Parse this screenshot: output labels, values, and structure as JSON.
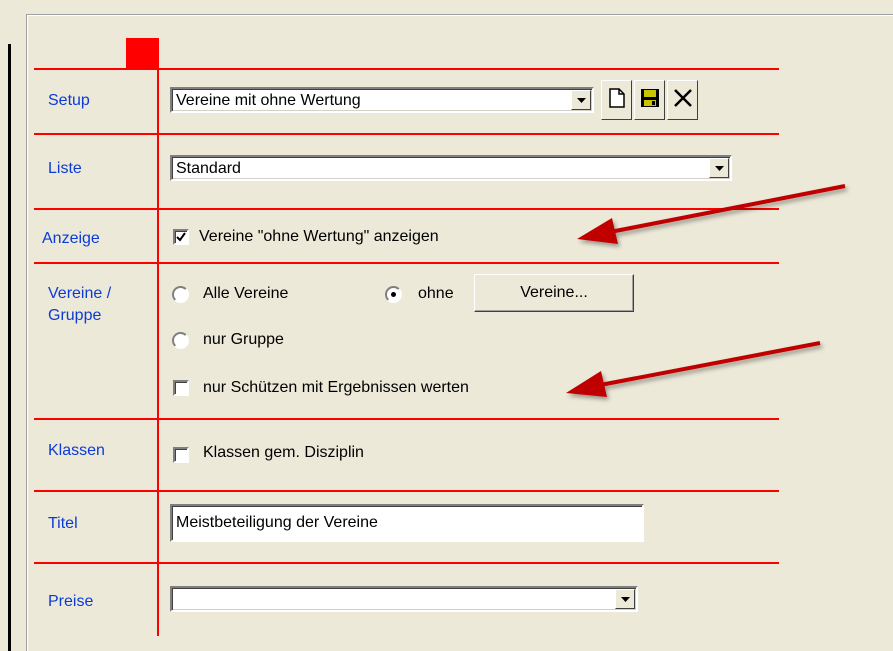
{
  "labels": {
    "setup": "Setup",
    "liste": "Liste",
    "anzeige": "Anzeige",
    "vereine_gruppe_1": "Vereine /",
    "vereine_gruppe_2": "Gruppe",
    "klassen": "Klassen",
    "titel": "Titel",
    "preise": "Preise"
  },
  "setup": {
    "selected": "Vereine mit ohne Wertung",
    "toolbar_icons": [
      "new-document-icon",
      "save-icon",
      "delete-icon"
    ]
  },
  "liste": {
    "selected": "Standard"
  },
  "anzeige": {
    "checkbox_label": "Vereine \"ohne Wertung\" anzeigen",
    "checked": true
  },
  "vereine": {
    "radio_all": "Alle Vereine",
    "radio_ohne": "ohne",
    "radio_gruppe": "nur Gruppe",
    "selected_radio": "ohne",
    "vereine_button": "Vereine...",
    "schuetzen_checkbox": "nur Schützen mit Ergebnissen werten",
    "schuetzen_checked": false
  },
  "klassen": {
    "checkbox_label": "Klassen gem. Disziplin",
    "checked": false
  },
  "titel": {
    "value": "Meistbeteiligung der Vereine"
  },
  "preise": {
    "selected": ""
  },
  "colors": {
    "label_blue": "#0b3bd6",
    "guide_red": "#ff0000",
    "annotation_arrow": "#c00000",
    "window_bg": "#ece9d8"
  }
}
